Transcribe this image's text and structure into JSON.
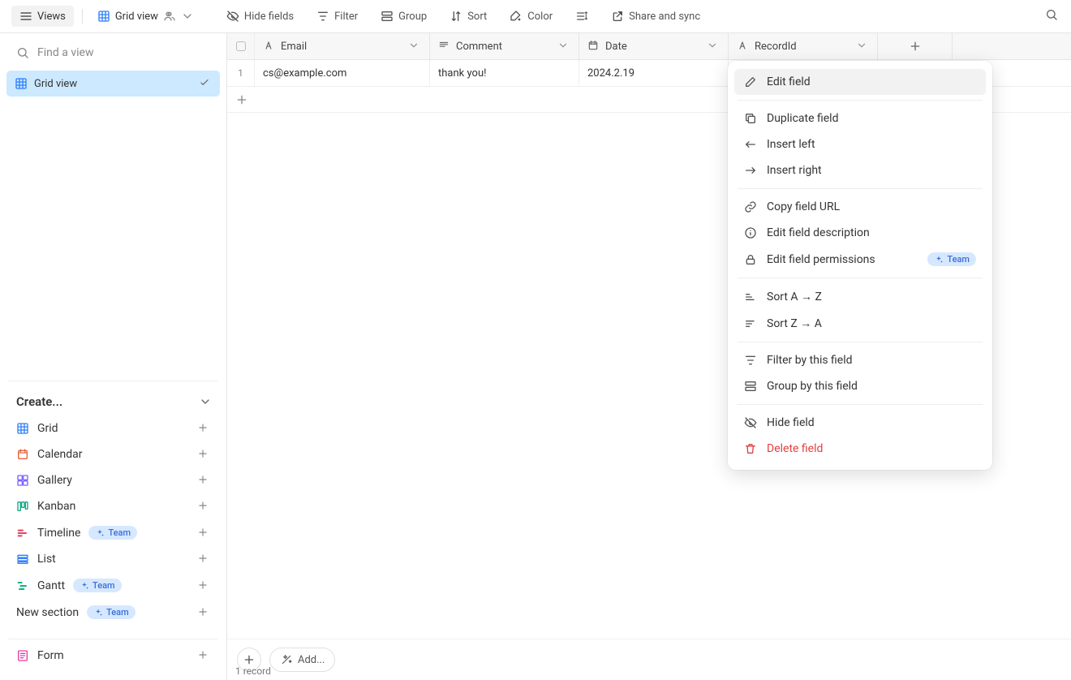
{
  "toolbar": {
    "views_label": "Views",
    "current_view": "Grid view",
    "hide_fields": "Hide fields",
    "filter": "Filter",
    "group": "Group",
    "sort": "Sort",
    "color": "Color",
    "share": "Share and sync"
  },
  "sidebar": {
    "search_placeholder": "Find a view",
    "views": [
      {
        "label": "Grid view"
      }
    ],
    "create_header": "Create...",
    "create_items": [
      {
        "label": "Grid",
        "icon": "grid",
        "team": false
      },
      {
        "label": "Calendar",
        "icon": "calendar",
        "team": false
      },
      {
        "label": "Gallery",
        "icon": "gallery",
        "team": false
      },
      {
        "label": "Kanban",
        "icon": "kanban",
        "team": false
      },
      {
        "label": "Timeline",
        "icon": "timeline",
        "team": true
      },
      {
        "label": "List",
        "icon": "list",
        "team": false
      },
      {
        "label": "Gantt",
        "icon": "gantt",
        "team": true
      }
    ],
    "new_section_label": "New section",
    "new_section_team": true,
    "form_label": "Form",
    "team_badge": "Team"
  },
  "columns": [
    {
      "label": "Email"
    },
    {
      "label": "Comment"
    },
    {
      "label": "Date"
    },
    {
      "label": "RecordId"
    }
  ],
  "rows": [
    {
      "num": "1",
      "cells": [
        "cs@example.com",
        "thank you!",
        "2024.2.19",
        ""
      ]
    }
  ],
  "footer": {
    "add_label": "Add...",
    "record_count": "1 record"
  },
  "context_menu": {
    "edit_field": "Edit field",
    "duplicate": "Duplicate field",
    "insert_left": "Insert left",
    "insert_right": "Insert right",
    "copy_url": "Copy field URL",
    "edit_desc": "Edit field description",
    "edit_perms": "Edit field permissions",
    "team_badge": "Team",
    "sort_az": "Sort A → Z",
    "sort_za": "Sort Z → A",
    "filter_by": "Filter by this field",
    "group_by": "Group by this field",
    "hide": "Hide field",
    "delete": "Delete field"
  }
}
